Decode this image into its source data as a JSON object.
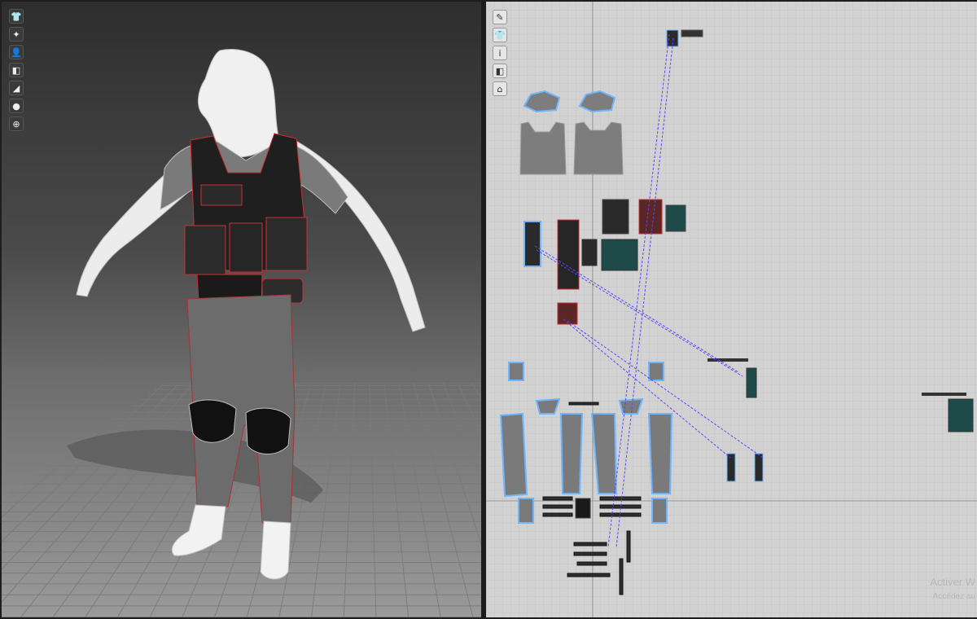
{
  "viewport3d": {
    "toolbar": [
      {
        "icon": "garment-icon",
        "glyph": "👕"
      },
      {
        "icon": "avatar-joints-icon",
        "glyph": "✦"
      },
      {
        "icon": "avatar-icon",
        "glyph": "👤"
      },
      {
        "icon": "texture-icon",
        "glyph": "◧"
      },
      {
        "icon": "shading-icon",
        "glyph": "◢"
      },
      {
        "icon": "avatar-skin-icon",
        "glyph": "●"
      },
      {
        "icon": "globe-icon",
        "glyph": "⊕"
      }
    ]
  },
  "viewport2d": {
    "toolbar": [
      {
        "icon": "pen-icon",
        "glyph": "✎"
      },
      {
        "icon": "garment-icon",
        "glyph": "👕"
      },
      {
        "icon": "info-icon",
        "glyph": "i"
      },
      {
        "icon": "texture-icon",
        "glyph": "◧"
      },
      {
        "icon": "arrangement-icon",
        "glyph": "⌂"
      }
    ]
  },
  "watermark": {
    "line1": "Activer W",
    "line2": "Accédez au"
  },
  "colors": {
    "accent_blue": "#6eb4ff",
    "seam_red": "#d23232",
    "link_purple": "#5a46ff"
  }
}
